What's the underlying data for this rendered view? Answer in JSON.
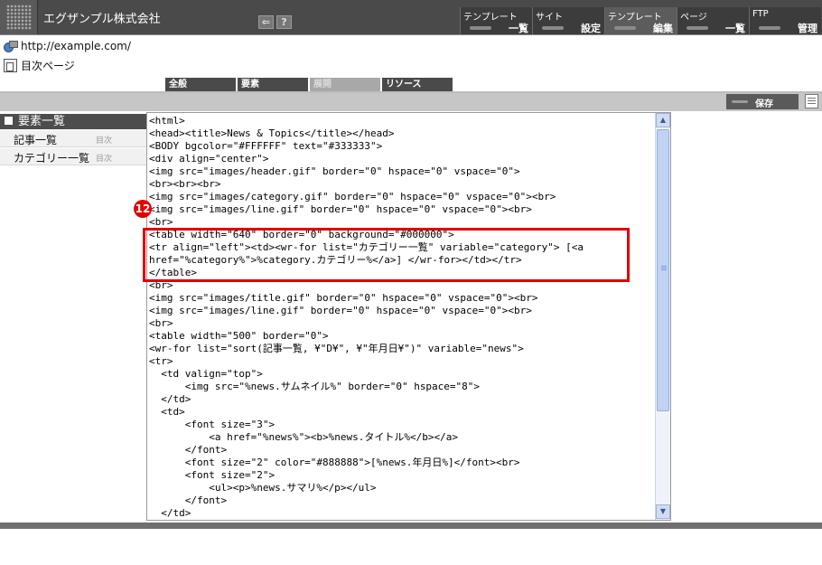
{
  "header": {
    "company_name": "エグザンプル株式会社",
    "help_label": "?",
    "nav": [
      {
        "top": "テンプレート",
        "bottom": "一覧"
      },
      {
        "top": "サイト",
        "bottom": "設定"
      },
      {
        "top": "テンプレート",
        "bottom": "編集"
      },
      {
        "top": "ページ",
        "bottom": "一覧"
      },
      {
        "top": "FTP",
        "bottom": "管理"
      }
    ]
  },
  "info": {
    "url": "http://example.com/",
    "page_name": "目次ページ"
  },
  "tabs": [
    {
      "label": "全般"
    },
    {
      "label": "要素"
    },
    {
      "label": "展開"
    },
    {
      "label": "リソース"
    }
  ],
  "toolbar": {
    "save_label": "保存"
  },
  "sidebar": {
    "title": "要素一覧",
    "items": [
      {
        "label": "記事一覧",
        "sub": "目次"
      },
      {
        "label": "カテゴリー一覧",
        "sub": "目次"
      }
    ]
  },
  "annotation": {
    "badge": "12"
  },
  "editor": {
    "lines": [
      "<html>",
      "<head><title>News & Topics</title></head>",
      "<BODY bgcolor=\"#FFFFFF\" text=\"#333333\">",
      "<div align=\"center\">",
      "<img src=\"images/header.gif\" border=\"0\" hspace=\"0\" vspace=\"0\">",
      "<br><br><br>",
      "<img src=\"images/category.gif\" border=\"0\" hspace=\"0\" vspace=\"0\"><br>",
      "<img src=\"images/line.gif\" border=\"0\" hspace=\"0\" vspace=\"0\"><br>",
      "<br>",
      "<table width=\"640\" border=\"0\" background=\"#000000\">",
      "<tr align=\"left\"><td><wr-for list=\"カテゴリー一覧\" variable=\"category\"> [<a",
      "href=\"%category%\">%category.カテゴリー%</a>] </wr-for></td></tr>",
      "</table>",
      "<br>",
      "<img src=\"images/title.gif\" border=\"0\" hspace=\"0\" vspace=\"0\"><br>",
      "<img src=\"images/line.gif\" border=\"0\" hspace=\"0\" vspace=\"0\"><br>",
      "<br>",
      "<table width=\"500\" border=\"0\">",
      "<wr-for list=\"sort(記事一覧, ¥\"D¥\", ¥\"年月日¥\")\" variable=\"news\">",
      "<tr>",
      "  <td valign=\"top\">",
      "      <img src=\"%news.サムネイル%\" border=\"0\" hspace=\"8\">",
      "  </td>",
      "  <td>",
      "      <font size=\"3\">",
      "          <a href=\"%news%\"><b>%news.タイトル%</b></a>",
      "      </font>",
      "      <font size=\"2\" color=\"#888888\">[%news.年月日%]</font><br>",
      "      <font size=\"2\">",
      "          <ul><p>%news.サマリ%</p></ul>",
      "      </font>",
      "  </td>"
    ]
  }
}
